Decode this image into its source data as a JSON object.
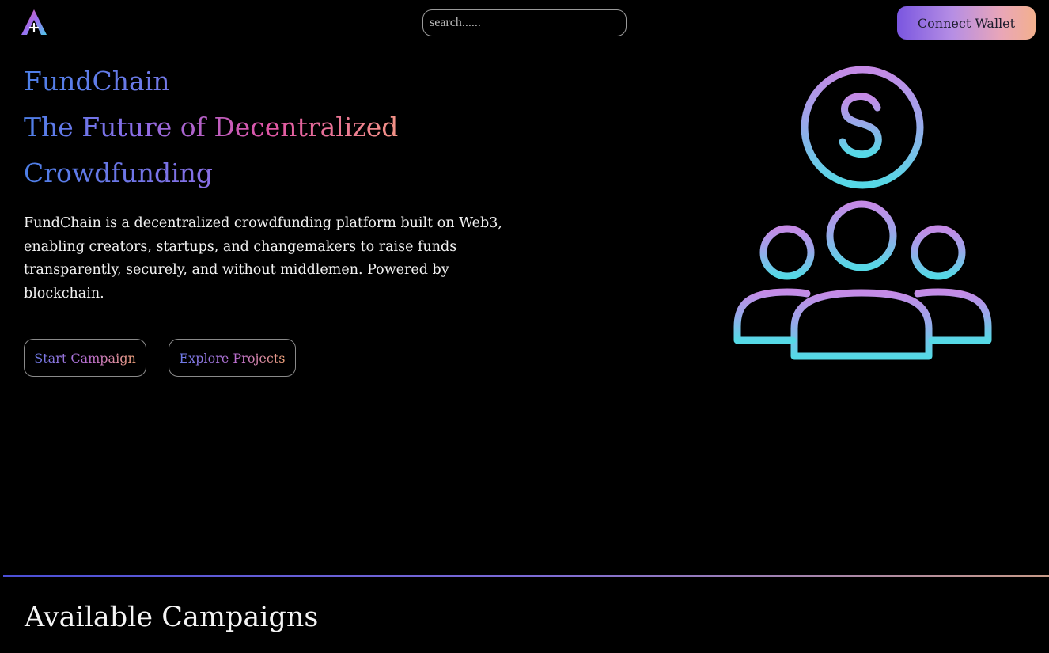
{
  "header": {
    "search": {
      "placeholder": "search......",
      "value": ""
    },
    "connect_wallet_label": "Connect Wallet"
  },
  "hero": {
    "title_line1": "FundChain",
    "title_line2": "The Future of Decentralized",
    "title_line3": "Crowdfunding",
    "description": "FundChain is a decentralized crowdfunding platform built on Web3, enabling creators, startups, and changemakers to raise funds transparently, securely, and without middlemen. Powered by blockchain.",
    "start_campaign_label": "Start Campaign",
    "explore_projects_label": "Explore Projects",
    "illustration_icon": "crowdfunding-people-dollar-icon"
  },
  "campaigns": {
    "title": "Available Campaigns"
  },
  "colors": {
    "background": "#000000",
    "accent_blue": "#4d7fe8",
    "accent_purple": "#b06ee6",
    "accent_pink": "#e055a6",
    "accent_cyan": "#4fd8e6",
    "accent_peach": "#f3b08e"
  }
}
